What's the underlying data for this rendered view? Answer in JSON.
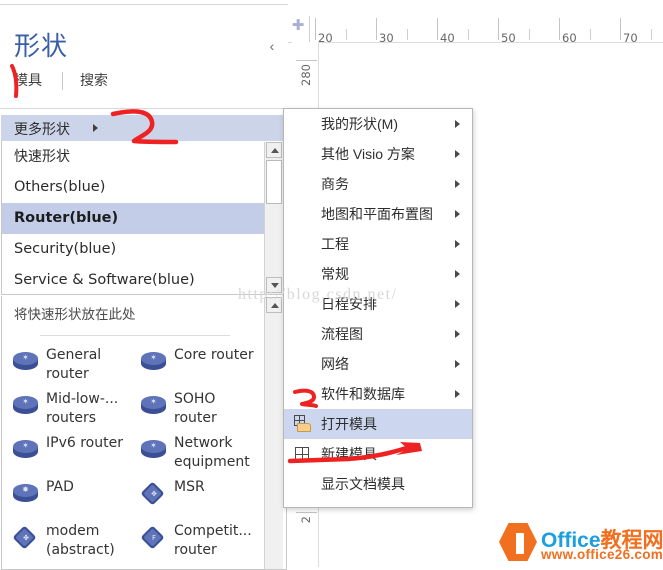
{
  "shapes_pane": {
    "title": "形状",
    "collapse_icon": "chevron-left-icon",
    "tabs": [
      {
        "label": "模具"
      },
      {
        "label": "搜索"
      }
    ],
    "more_shapes": {
      "label": "更多形状",
      "arrow_icon": "caret-right-icon"
    },
    "stencil_list": [
      {
        "label": "快速形状",
        "selected": false
      },
      {
        "label": "Others(blue)",
        "selected": false
      },
      {
        "label": "Router(blue)",
        "selected": true
      },
      {
        "label": "Security(blue)",
        "selected": false
      },
      {
        "label": "Service & Software(blue)",
        "selected": false
      }
    ],
    "quick_shapes_label": "将快速形状放在此处",
    "shape_items": [
      {
        "name": "General router",
        "icon": "router-puck-icon",
        "glyph": "✶"
      },
      {
        "name": "Core router",
        "icon": "router-puck-icon",
        "glyph": "✶"
      },
      {
        "name": "Mid-low-... routers",
        "icon": "router-puck-icon",
        "glyph": "✶"
      },
      {
        "name": "SOHO router",
        "icon": "router-puck-icon",
        "glyph": "✶"
      },
      {
        "name": "IPv6 router",
        "icon": "router-puck-icon",
        "glyph": "✶"
      },
      {
        "name": "Network equipment",
        "icon": "router-puck-icon",
        "glyph": "✶"
      },
      {
        "name": "PAD",
        "icon": "router-puck-icon",
        "glyph": "✸"
      },
      {
        "name": "MSR",
        "icon": "diamond-node-icon",
        "glyph": "✥"
      },
      {
        "name": "modem (abstract)",
        "icon": "diamond-node-icon",
        "glyph": "✤"
      },
      {
        "name": "Competit... router",
        "icon": "diamond-node-icon",
        "glyph": "F"
      }
    ],
    "scrollbars": {
      "up_icon": "triangle-up-icon",
      "down_icon": "triangle-down-icon"
    }
  },
  "menu": {
    "items": [
      {
        "label": "我的形状(M)",
        "submenu": true,
        "icon": null,
        "highlighted": false
      },
      {
        "label": "其他 Visio 方案",
        "submenu": true,
        "icon": null,
        "highlighted": false
      },
      {
        "label": "商务",
        "submenu": true,
        "icon": null,
        "highlighted": false
      },
      {
        "label": "地图和平面布置图",
        "submenu": true,
        "icon": null,
        "highlighted": false
      },
      {
        "label": "工程",
        "submenu": true,
        "icon": null,
        "highlighted": false
      },
      {
        "label": "常规",
        "submenu": true,
        "icon": null,
        "highlighted": false
      },
      {
        "label": "日程安排",
        "submenu": true,
        "icon": null,
        "highlighted": false
      },
      {
        "label": "流程图",
        "submenu": true,
        "icon": null,
        "highlighted": false
      },
      {
        "label": "网络",
        "submenu": true,
        "icon": null,
        "highlighted": false
      },
      {
        "label": "软件和数据库",
        "submenu": true,
        "icon": null,
        "highlighted": false
      },
      {
        "label": "打开模具",
        "submenu": false,
        "icon": "open-stencil-icon",
        "highlighted": true
      },
      {
        "label": "新建模具",
        "submenu": false,
        "icon": "new-stencil-icon",
        "highlighted": false
      },
      {
        "label": "显示文档模具",
        "submenu": false,
        "icon": null,
        "highlighted": false
      }
    ]
  },
  "rulers": {
    "horizontal_ticks": [
      "20",
      "30",
      "40",
      "50",
      "60",
      "70"
    ],
    "vertical_ticks": [
      "280",
      "2"
    ],
    "origin_icon": "ruler-origin-icon"
  },
  "annotations": [
    {
      "id": "1",
      "text": "1"
    },
    {
      "id": "2",
      "text": "2"
    },
    {
      "id": "3",
      "text": "3"
    }
  ],
  "watermarks": {
    "csdn": "http://blog.csdn.net/",
    "logo_title_en": "Office",
    "logo_title_cn": "教程网",
    "logo_url": "www.office26.com"
  },
  "colors": {
    "accent_blue": "#3a5fa8",
    "selection": "#c3cde8",
    "menu_highlight": "#ccd7ef",
    "annotation_red": "#ee2222",
    "logo_orange": "#f07020",
    "logo_blue": "#1a9fe0"
  }
}
